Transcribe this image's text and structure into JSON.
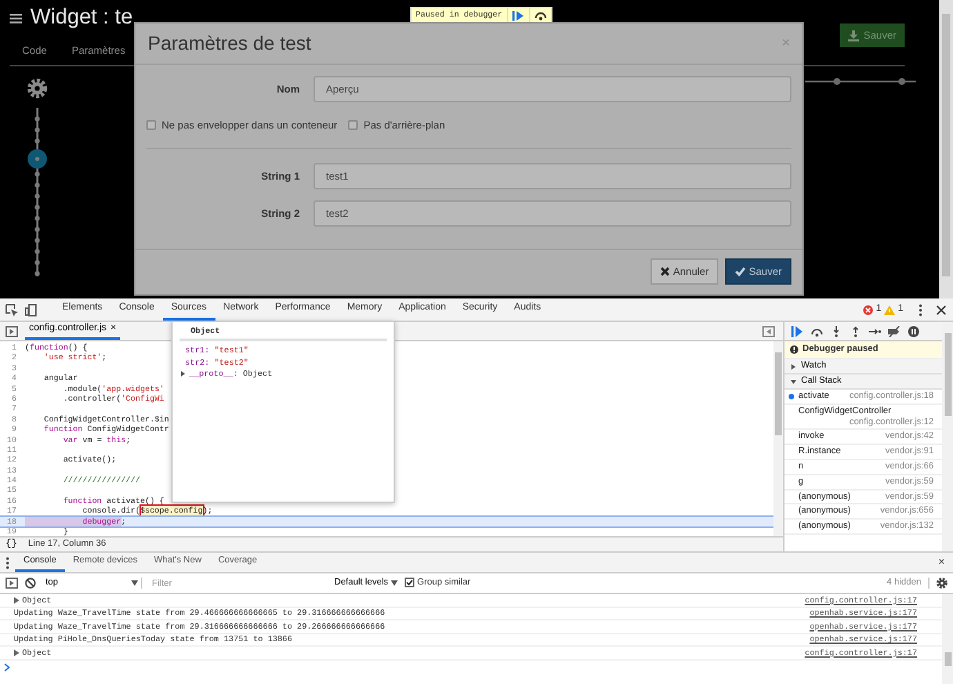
{
  "app": {
    "title": "Widget : te",
    "tabs": [
      {
        "label": "Code",
        "selected": false
      },
      {
        "label": "Paramètres",
        "selected": false
      }
    ],
    "save_button": "Sauver"
  },
  "debugger_banner": {
    "label": "Paused in debugger"
  },
  "dialog": {
    "title": "Paramètres de test",
    "close": "×",
    "name_field": {
      "label": "Nom",
      "value": "Aperçu"
    },
    "checkboxes": [
      {
        "label": "Ne pas envelopper dans un conteneur",
        "checked": false
      },
      {
        "label": "Pas d'arrière-plan",
        "checked": false
      }
    ],
    "string_fields": [
      {
        "label": "String 1",
        "value": "test1"
      },
      {
        "label": "String 2",
        "value": "test2"
      }
    ],
    "buttons": [
      {
        "label": "Annuler",
        "kind": "cancel"
      },
      {
        "label": "Sauver",
        "kind": "primary"
      }
    ]
  },
  "devtools": {
    "tabs": [
      {
        "label": "Elements",
        "selected": false
      },
      {
        "label": "Console",
        "selected": false
      },
      {
        "label": "Sources",
        "selected": true
      },
      {
        "label": "Network",
        "selected": false
      },
      {
        "label": "Performance",
        "selected": false
      },
      {
        "label": "Memory",
        "selected": false
      },
      {
        "label": "Application",
        "selected": false
      },
      {
        "label": "Security",
        "selected": false
      },
      {
        "label": "Audits",
        "selected": false
      }
    ],
    "error_count": "1",
    "warning_count": "1",
    "file_tab": {
      "label": "config.controller.js",
      "close": "×",
      "selected": true
    },
    "code_lines": [
      {
        "number": "1",
        "current": false,
        "tokens": [
          {
            "text": "(",
            "kind": "plain"
          },
          {
            "text": "function",
            "kind": "keyword"
          },
          {
            "text": "() {",
            "kind": "plain"
          }
        ]
      },
      {
        "number": "2",
        "current": false,
        "tokens": [
          {
            "text": "    'use strict'",
            "kind": "string"
          },
          {
            "text": ";",
            "kind": "plain"
          }
        ]
      },
      {
        "number": "3",
        "current": false
      },
      {
        "number": "4",
        "current": false,
        "tokens": [
          {
            "text": "    angular",
            "kind": "plain"
          }
        ]
      },
      {
        "number": "5",
        "current": false,
        "tokens": [
          {
            "text": "        .module(",
            "kind": "plain"
          },
          {
            "text": "'app.widgets'",
            "kind": "string"
          }
        ]
      },
      {
        "number": "6",
        "current": false,
        "tokens": [
          {
            "text": "        .controller(",
            "kind": "plain"
          },
          {
            "text": "'ConfigWi",
            "kind": "string"
          }
        ]
      },
      {
        "number": "7",
        "current": false
      },
      {
        "number": "8",
        "current": false,
        "tokens": [
          {
            "text": "    ConfigWidgetController.$in",
            "kind": "plain"
          }
        ]
      },
      {
        "number": "9",
        "current": false,
        "tokens": [
          {
            "text": "    function",
            "kind": "keyword"
          },
          {
            "text": " ConfigWidgetContr",
            "kind": "plain"
          }
        ]
      },
      {
        "number": "10",
        "current": false,
        "tokens": [
          {
            "text": "        var",
            "kind": "keyword"
          },
          {
            "text": " vm = ",
            "kind": "plain"
          },
          {
            "text": "this",
            "kind": "keyword"
          },
          {
            "text": ";",
            "kind": "plain"
          }
        ]
      },
      {
        "number": "11",
        "current": false
      },
      {
        "number": "12",
        "current": false,
        "tokens": [
          {
            "text": "        activate();",
            "kind": "plain"
          }
        ]
      },
      {
        "number": "13",
        "current": false
      },
      {
        "number": "14",
        "current": false,
        "tokens": [
          {
            "text": "        ////////////////",
            "kind": "comment"
          }
        ]
      },
      {
        "number": "15",
        "current": false
      },
      {
        "number": "16",
        "current": false,
        "tokens": [
          {
            "text": "        function",
            "kind": "keyword"
          },
          {
            "text": " activate() {",
            "kind": "plain"
          }
        ]
      },
      {
        "number": "17",
        "current": false,
        "tokens": [
          {
            "text": "            console.dir(",
            "kind": "plain"
          },
          {
            "text": "$scope.config",
            "kind": "highlight"
          },
          {
            "text": ");",
            "kind": "plain"
          }
        ]
      },
      {
        "number": "18",
        "current": true,
        "tokens": [
          {
            "text": "            debugger",
            "kind": "keyword"
          },
          {
            "text": ";",
            "kind": "plain"
          }
        ]
      },
      {
        "number": "19",
        "current": false,
        "tokens": [
          {
            "text": "        }",
            "kind": "plain"
          }
        ]
      }
    ],
    "popover": {
      "title": "Object",
      "properties": [
        {
          "key": "str1:",
          "value": "\"test1\""
        },
        {
          "key": "str2:",
          "value": "\"test2\""
        }
      ],
      "proto": {
        "key": "__proto__:",
        "value": "Object",
        "expanded": false
      }
    },
    "format_button": "{}",
    "status": "Line 17, Column 36",
    "paused_message": "Debugger paused",
    "sections": [
      {
        "label": "Watch",
        "expanded": false
      },
      {
        "label": "Call Stack",
        "expanded": true
      }
    ],
    "call_stack": [
      {
        "function": "activate",
        "location": "config.controller.js:18",
        "selected": true
      },
      {
        "function": "ConfigWidgetController",
        "location": "config.controller.js:12",
        "selected": false
      },
      {
        "function": "invoke",
        "location": "vendor.js:42",
        "selected": false
      },
      {
        "function": "R.instance",
        "location": "vendor.js:91",
        "selected": false
      },
      {
        "function": "n",
        "location": "vendor.js:66",
        "selected": false
      },
      {
        "function": "g",
        "location": "vendor.js:59",
        "selected": false
      },
      {
        "function": "(anonymous)",
        "location": "vendor.js:59",
        "selected": false
      },
      {
        "function": "(anonymous)",
        "location": "vendor.js:656",
        "selected": false
      },
      {
        "function": "(anonymous)",
        "location": "vendor.js:132",
        "selected": false
      }
    ]
  },
  "console": {
    "tabs": [
      {
        "label": "Console",
        "selected": true
      },
      {
        "label": "Remote devices",
        "selected": false
      },
      {
        "label": "What's New",
        "selected": false
      },
      {
        "label": "Coverage",
        "selected": false
      }
    ],
    "close": "×",
    "context": "top",
    "filter_placeholder": "Filter",
    "levels": "Default levels",
    "group_similar": {
      "label": "Group similar",
      "checked": true
    },
    "hidden": "4 hidden",
    "messages": [
      {
        "kind": "object",
        "text": "Object",
        "source": "config.controller.js:17"
      },
      {
        "kind": "log",
        "text": "Updating Waze_TravelTime state from 29.466666666666665 to 29.316666666666666",
        "source": "openhab.service.js:177"
      },
      {
        "kind": "log",
        "text": "Updating Waze_TravelTime state from 29.316666666666666 to 29.266666666666666",
        "source": "openhab.service.js:177"
      },
      {
        "kind": "log",
        "text": "Updating PiHole_DnsQueriesToday state from 13751 to 13866",
        "source": "openhab.service.js:177"
      },
      {
        "kind": "object",
        "text": "Object",
        "source": "config.controller.js:17"
      }
    ]
  }
}
